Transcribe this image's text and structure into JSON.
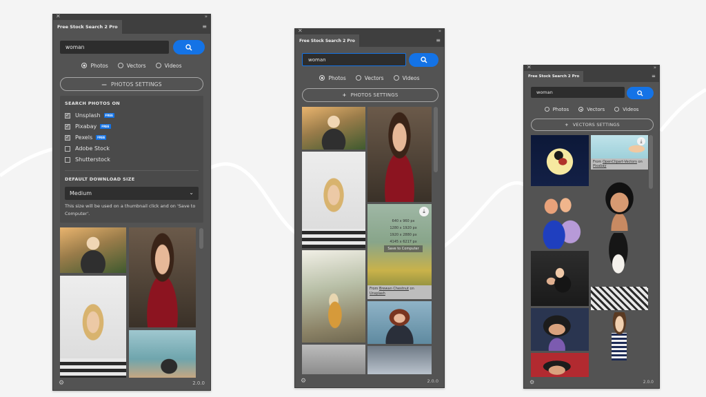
{
  "panels": [
    {
      "title": "Free Stock Search 2 Pro",
      "search": {
        "value": "woman"
      },
      "radios": [
        {
          "label": "Photos",
          "selected": true
        },
        {
          "label": "Vectors",
          "selected": false
        },
        {
          "label": "Videos",
          "selected": false
        }
      ],
      "settings_button": {
        "symbol": "—",
        "label": "PHOTOS SETTINGS"
      },
      "settings": {
        "search_on_header": "SEARCH PHOTOS ON",
        "sources": [
          {
            "label": "Unsplash",
            "checked": true,
            "free": true
          },
          {
            "label": "Pixabay",
            "checked": true,
            "free": true
          },
          {
            "label": "Pexels",
            "checked": true,
            "free": true
          },
          {
            "label": "Adobe Stock",
            "checked": false,
            "free": false
          },
          {
            "label": "Shutterstock",
            "checked": false,
            "free": false
          }
        ],
        "free_badge": "FREE",
        "download_size_header": "DEFAULT DOWNLOAD SIZE",
        "download_size_value": "Medium",
        "download_size_note": "This size will be used on a thumbnail click and on 'Save to Computer'."
      },
      "version": "2.0.0"
    },
    {
      "title": "Free Stock Search 2 Pro",
      "search": {
        "value": "woman"
      },
      "radios": [
        {
          "label": "Photos",
          "selected": true
        },
        {
          "label": "Vectors",
          "selected": false
        },
        {
          "label": "Videos",
          "selected": false
        }
      ],
      "settings_button": {
        "symbol": "+",
        "label": "PHOTOS SETTINGS"
      },
      "hover_overlay": {
        "sizes": [
          "640 x 960 px",
          "1280 x 1920 px",
          "1920 x 2880 px",
          "4145 x 6217 px"
        ],
        "save_label": "Save to Computer",
        "credit_from": "From",
        "credit_author": "Brewan Chestnut",
        "credit_on": "on",
        "credit_site": "Unsplash"
      },
      "version": "2.0.0"
    },
    {
      "title": "Free Stock Search 2 Pro",
      "search": {
        "value": "woman"
      },
      "radios": [
        {
          "label": "Photos",
          "selected": false
        },
        {
          "label": "Vectors",
          "selected": true
        },
        {
          "label": "Videos",
          "selected": false
        }
      ],
      "settings_button": {
        "symbol": "+",
        "label": "VECTORS SETTINGS"
      },
      "hover_overlay": {
        "credit_from": "From",
        "credit_author": "OpenClipart-Vectors",
        "credit_on": "on",
        "credit_site": "Pixabay"
      },
      "version": "2.0.0"
    }
  ],
  "icons": {
    "close": "close-icon",
    "collapse": "collapse-icon",
    "menu": "menu-icon",
    "search": "search-icon",
    "settings": "gear-icon",
    "download": "download-icon"
  },
  "colors": {
    "panel_bg": "#535353",
    "accent": "#1473e6",
    "page_bg": "#f4f4f4"
  }
}
